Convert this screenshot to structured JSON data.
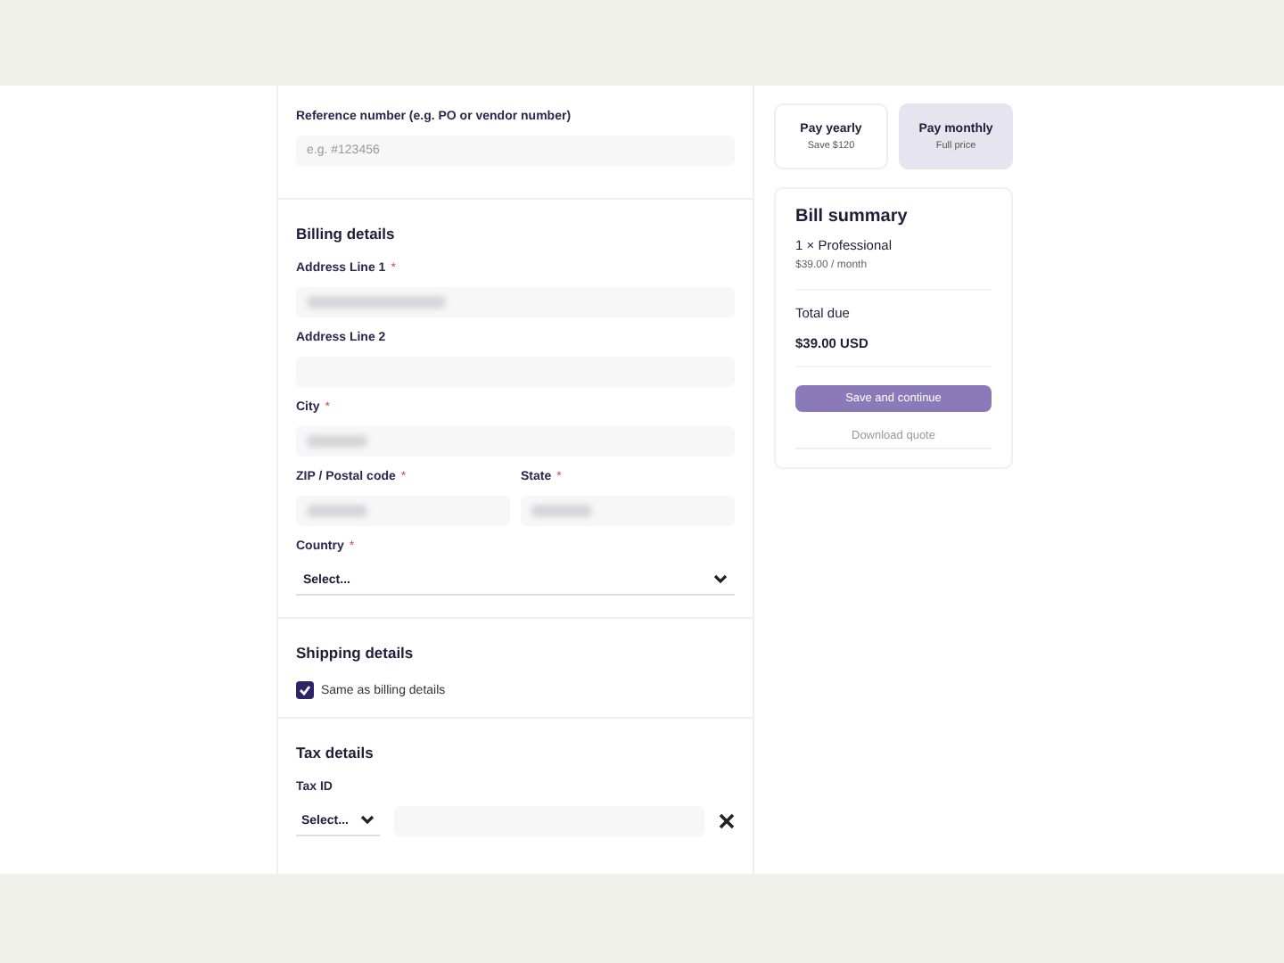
{
  "reference": {
    "label": "Reference number (e.g. PO or vendor number)",
    "placeholder": "e.g. #123456"
  },
  "billing": {
    "title": "Billing details",
    "fields": [
      {
        "kind": "text",
        "label": "Address Line 1",
        "required_mark": "*",
        "redacted": true
      },
      {
        "kind": "text",
        "label": "Address Line 2",
        "redacted": false
      },
      {
        "kind": "text",
        "label": "City",
        "required_mark": "*",
        "redacted": true
      },
      {
        "kind": "pair",
        "items": [
          {
            "label": "ZIP / Postal code",
            "required_mark": "*",
            "redacted": true
          },
          {
            "label": "State",
            "required_mark": "*",
            "redacted": true
          }
        ]
      },
      {
        "kind": "select",
        "label": "Country",
        "required_mark": "*",
        "value": "Select..."
      }
    ]
  },
  "shipping": {
    "title": "Shipping details",
    "same_as_billing": {
      "label": "Same as billing details",
      "checked": true
    }
  },
  "tax": {
    "title": "Tax details",
    "label": "Tax ID",
    "select": "Select..."
  },
  "plans": [
    {
      "title": "Pay yearly",
      "subtitle": "Save $120",
      "selected": false
    },
    {
      "title": "Pay monthly",
      "subtitle": "Full price",
      "selected": true
    }
  ],
  "summary": {
    "title": "Bill summary",
    "item": "1 × Professional",
    "price": "$39.00 / month",
    "total_label": "Total due",
    "total": "$39.00 USD"
  },
  "buttons": {
    "primary": "Save and continue",
    "secondary": "Download quote"
  }
}
